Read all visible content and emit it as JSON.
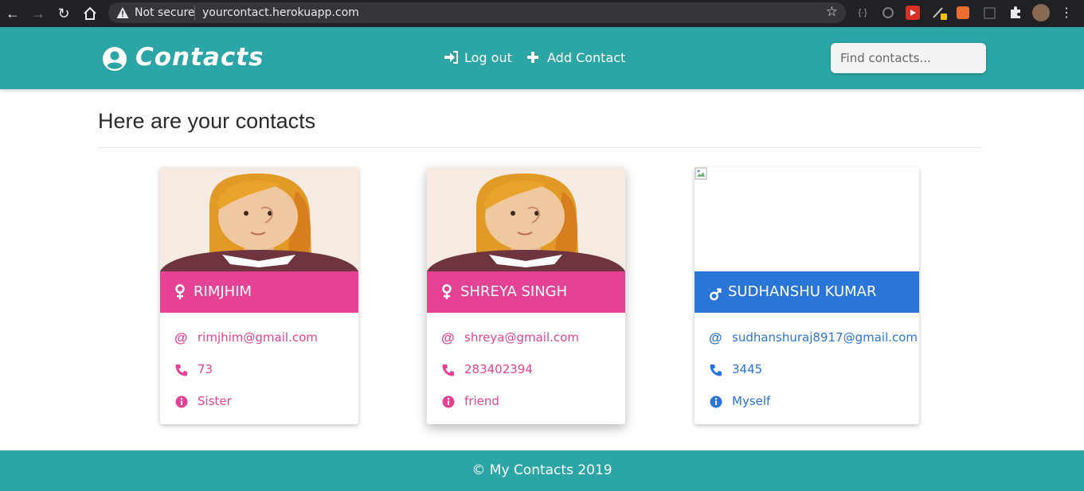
{
  "browser": {
    "security_label": "Not secure",
    "url": "yourcontact.herokuapp.com"
  },
  "navbar": {
    "brand": "Contacts",
    "logout_label": "Log out",
    "add_contact_label": "Add Contact",
    "search_placeholder": "Find contacts..."
  },
  "page": {
    "title": "Here are your contacts"
  },
  "colors": {
    "teal": "#2ba5a5",
    "female": "#e54295",
    "male": "#2a75d8"
  },
  "contacts": [
    {
      "name": "RIMJHIM",
      "gender": "female",
      "email": "rimjhim@gmail.com",
      "phone": "73",
      "relation": "Sister"
    },
    {
      "name": "SHREYA SINGH",
      "gender": "female",
      "email": "shreya@gmail.com",
      "phone": "283402394",
      "relation": "friend"
    },
    {
      "name": "SUDHANSHU KUMAR",
      "gender": "male",
      "email": "sudhanshuraj8917@gmail.com",
      "phone": "3445",
      "relation": "Myself"
    }
  ],
  "footer": {
    "text": "© My Contacts 2019"
  }
}
